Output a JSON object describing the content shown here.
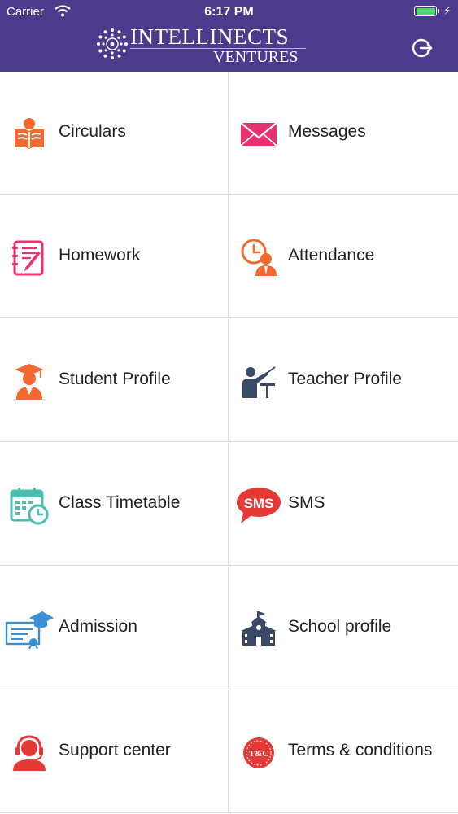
{
  "status_bar": {
    "carrier": "Carrier",
    "time": "6:17 PM"
  },
  "header": {
    "brand_line1": "INTELLINECTS",
    "brand_line2": "VENTURES",
    "logout_icon": "logout-icon"
  },
  "colors": {
    "header_bg": "#4c3b8c",
    "accent_orange": "#f26a2e",
    "accent_pink": "#e8326e",
    "accent_red": "#e53935",
    "accent_teal": "#4bbfae",
    "accent_blue": "#3a8fd6",
    "accent_navy": "#3a4a66",
    "battery": "#4cd964"
  },
  "menu": [
    {
      "label": "Circulars",
      "icon": "reading-book-icon"
    },
    {
      "label": "Messages",
      "icon": "envelope-icon"
    },
    {
      "label": "Homework",
      "icon": "notebook-pencil-icon"
    },
    {
      "label": "Attendance",
      "icon": "clock-person-icon"
    },
    {
      "label": "Student Profile",
      "icon": "graduate-icon"
    },
    {
      "label": "Teacher Profile",
      "icon": "teacher-board-icon"
    },
    {
      "label": "Class Timetable",
      "icon": "calendar-clock-icon"
    },
    {
      "label": "SMS",
      "icon": "sms-bubble-icon",
      "icon_text": "SMS"
    },
    {
      "label": "Admission",
      "icon": "certificate-icon"
    },
    {
      "label": "School profile",
      "icon": "school-building-icon"
    },
    {
      "label": "Support center",
      "icon": "headset-icon"
    },
    {
      "label": "Terms & conditions",
      "icon": "terms-badge-icon",
      "icon_text": "T&C"
    }
  ]
}
